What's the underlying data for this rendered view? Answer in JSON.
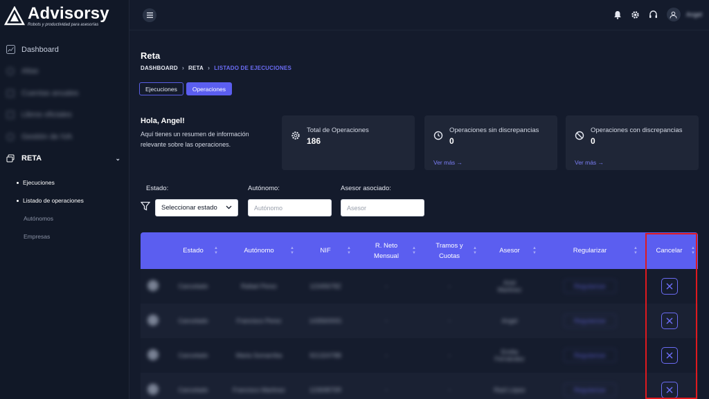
{
  "brand": {
    "name": "Advisorsy",
    "tagline": "Robots y productividad para asesorías"
  },
  "sidebar": {
    "items": [
      {
        "label": "Dashboard",
        "icon": "chart-line-icon"
      },
      {
        "label": "Altas",
        "icon": "user-plus-icon"
      },
      {
        "label": "Cuentas anuales",
        "icon": "file-icon"
      },
      {
        "label": "Libros oficiales",
        "icon": "book-icon"
      },
      {
        "label": "Gestión de IVA",
        "icon": "receipt-icon"
      },
      {
        "label": "RETA",
        "icon": "stack-icon",
        "expanded": true
      }
    ],
    "subitems": [
      {
        "label": "Ejecuciones"
      },
      {
        "label": "Listado de operaciones"
      },
      {
        "label": "Autónomos"
      },
      {
        "label": "Empresas"
      }
    ]
  },
  "topbar": {
    "username": "Angel"
  },
  "page": {
    "title": "Reta",
    "breadcrumb": [
      "DASHBOARD",
      "RETA",
      "LISTADO DE EJECUCIONES"
    ],
    "tabs": [
      "Ejecuciones",
      "Operaciones"
    ],
    "greeting": {
      "title": "Hola, Angel!",
      "text": "Aquí tienes un resumen de información relevante sobre las operaciones."
    },
    "cards": [
      {
        "title": "Total de Operaciones",
        "value": "186",
        "link": ""
      },
      {
        "title": "Operaciones sin discrepancias",
        "value": "0",
        "link": "Ver más →"
      },
      {
        "title": "Operaciones con discrepancias",
        "value": "0",
        "link": "Ver más →"
      }
    ],
    "filters": {
      "estado_label": "Estado:",
      "estado_value": "Seleccionar estado",
      "autonomo_label": "Autónomo:",
      "autonomo_placeholder": "Autónomo",
      "asesor_label": "Asesor asociado:",
      "asesor_placeholder": "Asesor"
    }
  },
  "table": {
    "headers": [
      "",
      "Estado",
      "Autónomo",
      "NIF",
      "R. Neto Mensual",
      "Tramos y Cuotas",
      "Asesor",
      "Regularizar",
      "Cancelar"
    ],
    "regularize_label": "Regularizar",
    "rows": [
      {
        "estado": "Cancelado",
        "autonomo": "Rafael Perez",
        "nif": "12345678Z",
        "neto": "-",
        "tramos": "-",
        "asesor": "Ariel Martinez"
      },
      {
        "estado": "Cancelado",
        "autonomo": "Francisco Perez",
        "nif": "14356000G",
        "neto": "-",
        "tramos": "-",
        "asesor": "Angel"
      },
      {
        "estado": "Cancelado",
        "autonomo": "Maria Somarriba",
        "nif": "92132478B",
        "neto": "-",
        "tramos": "-",
        "asesor": "Emilia Fernández"
      },
      {
        "estado": "Cancelado",
        "autonomo": "Francisco Martinez",
        "nif": "12369875R",
        "neto": "-",
        "tramos": "-",
        "asesor": "Raúl López"
      }
    ]
  },
  "colors": {
    "accent": "#5b5ef0",
    "sidebar_bg": "#111827",
    "page_bg": "#141b2c",
    "highlight": "#e0191e"
  }
}
